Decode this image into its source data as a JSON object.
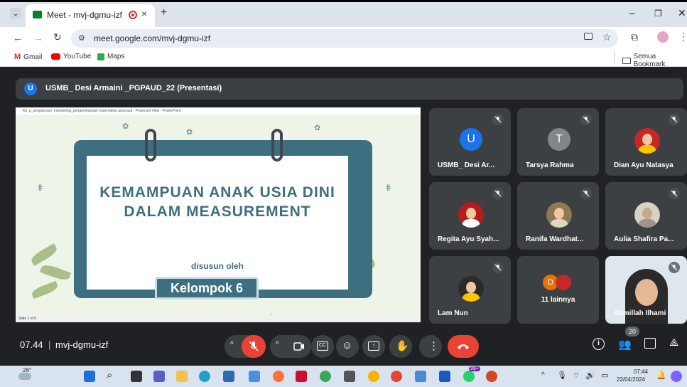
{
  "browser": {
    "tab_title": "Meet - mvj-dgmu-izf",
    "url": "meet.google.com/mvj-dgmu-izf",
    "bookmarks": [
      {
        "label": "Gmail",
        "icon": "gmail-icon"
      },
      {
        "label": "YouTube",
        "icon": "youtube-icon"
      },
      {
        "label": "Maps",
        "icon": "maps-icon"
      }
    ],
    "all_bookmarks": "Semua Bookmark"
  },
  "meet": {
    "presenter_initial": "U",
    "presenter_label": "USMB_ Desi Armaini _PGPAUD_22 (Presentasi)",
    "slide": {
      "window_title": "Kb_p_pengukuran_metodologi_pengembangan matematika awal.aud  -  Protected View - PowerPoint",
      "title": "KEMAMPUAN ANAK USIA DINI DALAM MEASUREMENT",
      "byline": "disusun oleh",
      "group": "Kelompok 6",
      "status": "Slide 1 of 6"
    },
    "participants": [
      {
        "name": "USMB_ Desi Ar...",
        "initial": "U",
        "avatar_color": "#1a73e8",
        "type": "letter"
      },
      {
        "name": "Tarsya Rahma",
        "initial": "T",
        "avatar_color": "#80868b",
        "type": "letter"
      },
      {
        "name": "Dian Ayu Natasya",
        "type": "photo"
      },
      {
        "name": "Regita Ayu Syah...",
        "type": "photo"
      },
      {
        "name": "Ranifa Wardhat...",
        "type": "photo"
      },
      {
        "name": "Aulia Shafira Pa...",
        "type": "photo"
      },
      {
        "name": "Lam Nun",
        "type": "photo"
      },
      {
        "name": "11 lainnya",
        "initial": "D",
        "type": "others"
      },
      {
        "name": "Akmillah Ilhami",
        "type": "video"
      }
    ]
  },
  "toolbar": {
    "time": "07.44",
    "meeting_code": "mvj-dgmu-izf",
    "participant_count": "20"
  },
  "taskbar": {
    "temperature": "26°",
    "clock_time": "07:44",
    "clock_date": "22/04/2024",
    "badge": "99+"
  }
}
